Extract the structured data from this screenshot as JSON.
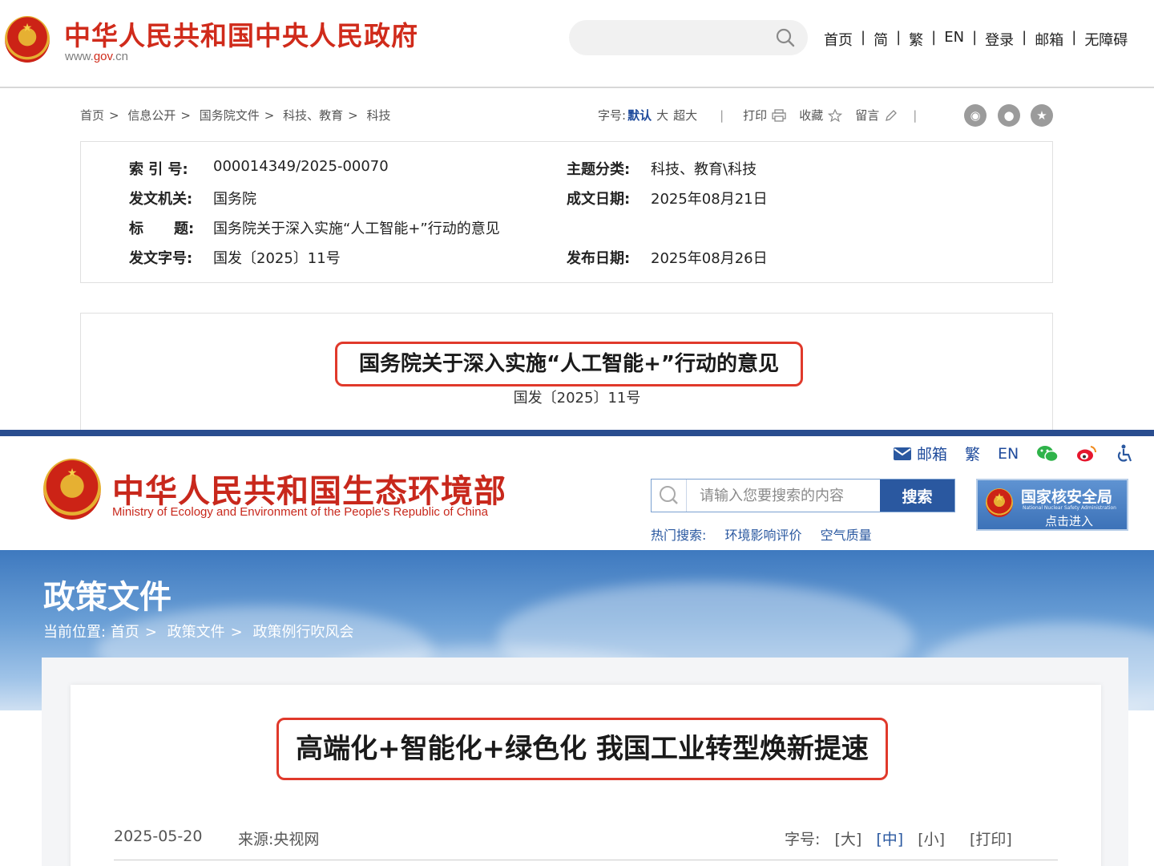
{
  "gov": {
    "site_title": "中华人民共和国中央人民政府",
    "site_url_prefix": "www.",
    "site_url_brand": "gov",
    "site_url_suffix": ".cn",
    "search_icon": "search-icon",
    "topnav": [
      "首页",
      "简",
      "繁",
      "EN",
      "登录",
      "邮箱",
      "无障碍"
    ],
    "breadcrumb": [
      "首页",
      "信息公开",
      "国务院文件",
      "科技、教育",
      "科技"
    ],
    "font_size_label": "字号:",
    "font_sizes": [
      "默认",
      "大",
      "超大"
    ],
    "print_label": "打印",
    "favorite_label": "收藏",
    "message_label": "留言",
    "meta": {
      "index_no_label": "索 引 号:",
      "index_no": "000014349/2025-00070",
      "topic_label": "主题分类:",
      "topic": "科技、教育\\科技",
      "issuer_label": "发文机关:",
      "issuer": "国务院",
      "written_date_label": "成文日期:",
      "written_date": "2025年08月21日",
      "title_label_1": "标",
      "title_label_2": "题:",
      "title": "国务院关于深入实施“人工智能+”行动的意见",
      "doc_no_label": "发文字号:",
      "doc_no": "国发〔2025〕11号",
      "publish_date_label": "发布日期:",
      "publish_date": "2025年08月26日"
    },
    "article_title": "国务院关于深入实施“人工智能+”行动的意见",
    "article_doc_no": "国发〔2025〕11号"
  },
  "mee": {
    "top_links": [
      "邮箱",
      "繁",
      "EN"
    ],
    "title": "中华人民共和国生态环境部",
    "subtitle": "Ministry of Ecology and Environment of the People's Republic of China",
    "search_placeholder": "请输入您要搜索的内容",
    "search_button": "搜索",
    "hot_label": "热门搜索:",
    "hot_items": [
      "环境影响评价",
      "空气质量"
    ],
    "nnsa_title": "国家核安全局",
    "nnsa_tiny": "National Nuclear Safety Administration",
    "nnsa_enter": "点击进入",
    "banner_title": "政策文件",
    "location_label": "当前位置:",
    "breadcrumb": [
      "首页",
      "政策文件",
      "政策例行吹风会"
    ],
    "article_title": "高端化+智能化+绿色化 我国工业转型焕新提速",
    "date": "2025-05-20",
    "source": "来源:央视网",
    "font_label": "字号:",
    "font_opts": [
      "[大]",
      "[中]",
      "[小]"
    ],
    "print": "[打印]",
    "accent": "#2a58a0",
    "highlight": "#e0392b"
  }
}
